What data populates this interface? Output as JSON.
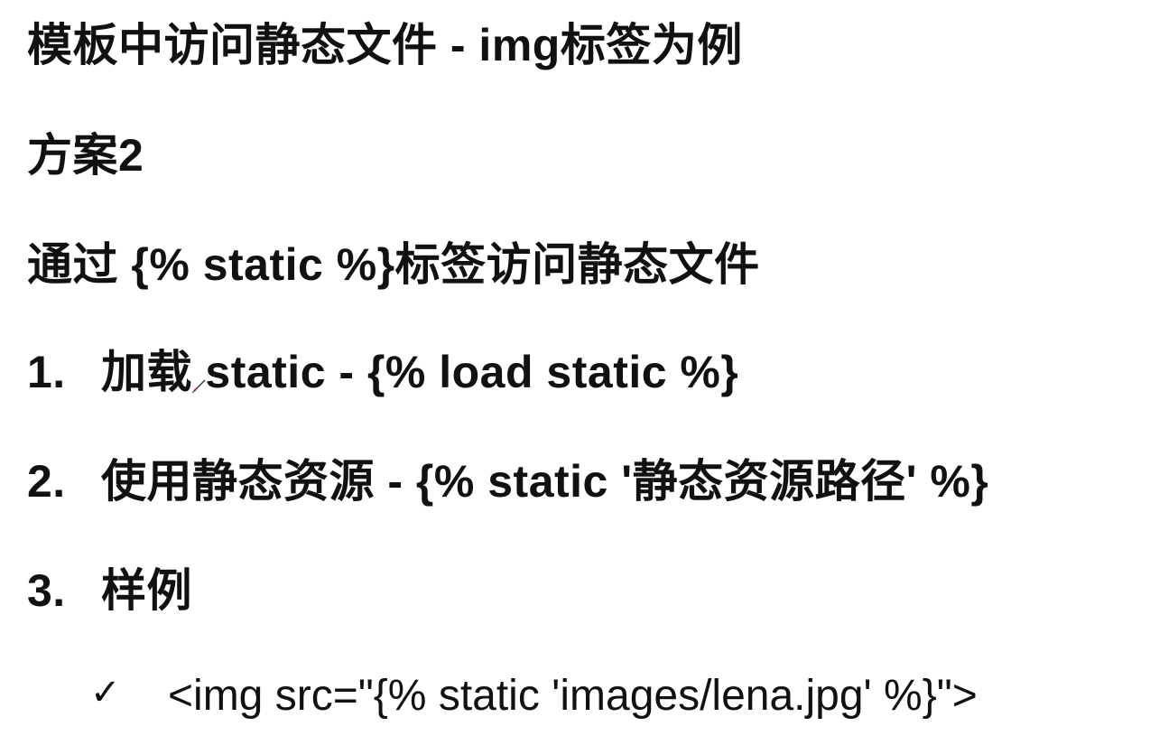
{
  "slide": {
    "title": "模板中访问静态文件 - img标签为例",
    "plan": "方案2",
    "intro": "通过 {% static %}标签访问静态文件",
    "items": [
      {
        "number": "1.",
        "text": "加载 static - {% load static %}"
      },
      {
        "number": "2.",
        "text": "使用静态资源 - {% static '静态资源路径' %}"
      },
      {
        "number": "3.",
        "text": "样例"
      }
    ],
    "example": {
      "bullet": "✓",
      "code": "<img src=\"{% static 'images/lena.jpg' %}\">"
    }
  },
  "icons": {
    "cursor": "pen-cursor-icon"
  },
  "colors": {
    "text": "#111111",
    "background": "#ffffff",
    "cursor_accent": "#d32f2f"
  }
}
